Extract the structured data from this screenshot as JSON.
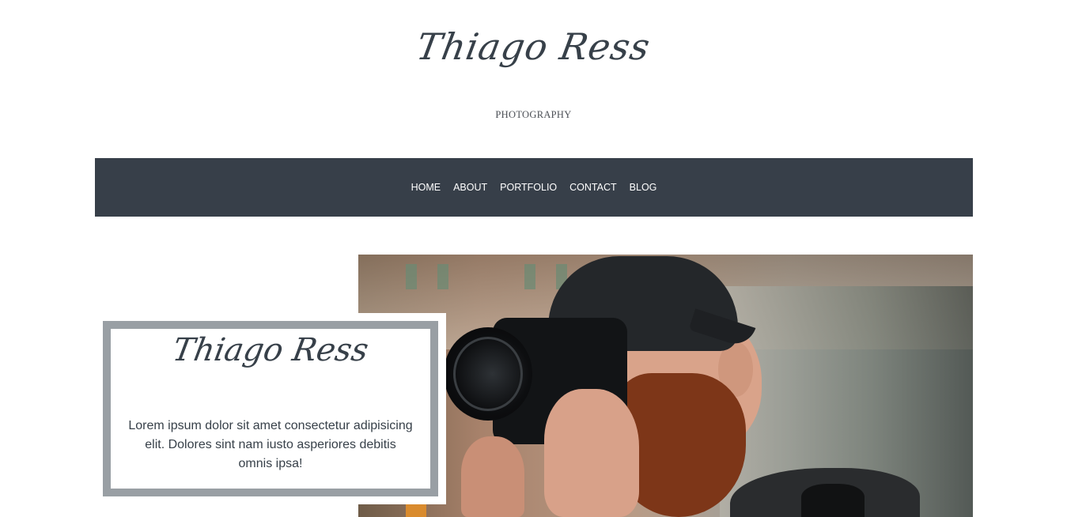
{
  "header": {
    "logo_text": "Thiago Ress",
    "subtitle": "PHOTOGRAPHY"
  },
  "nav": {
    "items": [
      "HOME",
      "ABOUT",
      "PORTFOLIO",
      "CONTACT",
      "BLOG"
    ]
  },
  "colors": {
    "nav_background": "#373f49",
    "text": "#374049",
    "card_frame": "#999fa4"
  },
  "hero": {
    "image": "photographer-with-camera-image"
  },
  "card": {
    "logo_text": "Thiago Ress",
    "description": "Lorem ipsum dolor sit amet consectetur adipisicing elit. Dolores sint nam iusto asperiores debitis omnis ipsa!"
  }
}
